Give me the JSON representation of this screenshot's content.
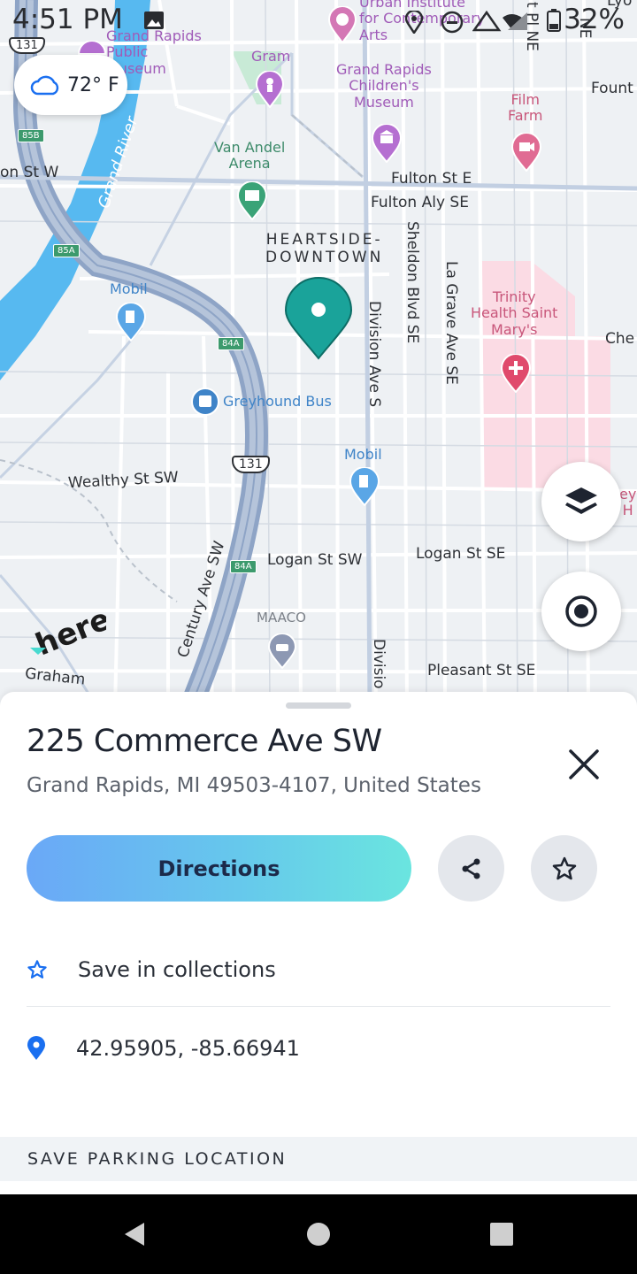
{
  "status_bar": {
    "time": "4:51 PM",
    "battery": "32%"
  },
  "weather": {
    "temperature": "72° F",
    "icon": "cloud-icon"
  },
  "map": {
    "streets": {
      "fulton_st_w": "on St W",
      "fulton_st_e": "Fulton St E",
      "fulton_aly_se": "Fulton Aly SE",
      "sheldon": "Sheldon Blvd SE",
      "la_grave": "La Grave Ave SE",
      "division": "Division Ave S",
      "division_bottom": "Divisio",
      "wealthy": "Wealthy St SW",
      "century": "Century Ave SW",
      "logan_sw": "Logan St SW",
      "logan_se": "Logan St SE",
      "pleasant": "Pleasant St SE",
      "graham": "Graham",
      "che": "Che",
      "fount": "Fount",
      "lyo": "Lyo",
      "pl_ne": "t Pl NE",
      "ne": "NE"
    },
    "river_label": "Grand River",
    "district": "HEARTSIDE-\nDOWNTOWN",
    "pois": {
      "library": "Grand Rapids\nPublic\nMuseum",
      "gram": "Gram",
      "urban_institute": "Urban Institute\nfor Contemporary\nArts",
      "childrens_museum": "Grand Rapids\nChildren's\nMuseum",
      "film_farm": "Film\nFarm",
      "van_andel": "Van Andel\nArena",
      "mobil_1": "Mobil",
      "mobil_2": "Mobil",
      "greyhound": "Greyhound Bus",
      "trinity": "Trinity\nHealth Saint\nMary's",
      "maaco": "MAACO",
      "ey": "ey\nH"
    },
    "shields": {
      "s85b": "85B",
      "s85a": "85A",
      "s84a_1": "84A",
      "s84a_2": "84A",
      "us131": "131",
      "us131_top": "131"
    },
    "logo": "here"
  },
  "place": {
    "title": "225 Commerce Ave SW",
    "subtitle": "Grand Rapids, MI 49503-4107, United States",
    "directions_label": "Directions",
    "save_collections_label": "Save in collections",
    "coordinates": "42.95905, -85.66941",
    "parking_section": "SAVE PARKING LOCATION"
  },
  "colors": {
    "marker": "#1aa39a",
    "accent_blue": "#1a6ff0",
    "directions_gradient_start": "#6aa8f7",
    "directions_gradient_end": "#6ae5df"
  }
}
